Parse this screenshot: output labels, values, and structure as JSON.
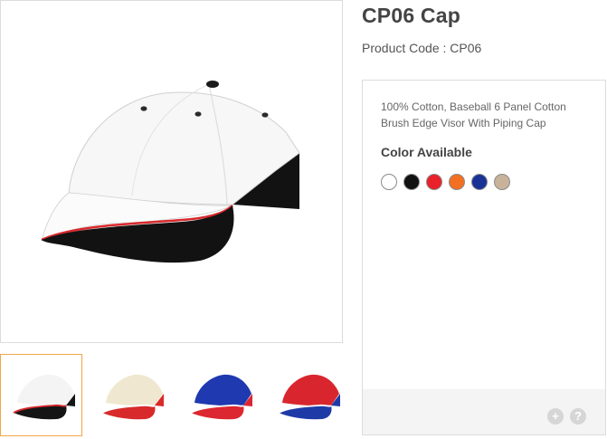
{
  "product": {
    "title": "CP06 Cap",
    "code_label": "Product Code : ",
    "code": "CP06",
    "description": "100% Cotton, Baseball 6 Panel Cotton Brush Edge Visor With Piping Cap",
    "color_heading": "Color Available"
  },
  "colors": [
    {
      "name": "white-swatch",
      "hex": "#ffffff"
    },
    {
      "name": "black-swatch",
      "hex": "#111111"
    },
    {
      "name": "red-swatch",
      "hex": "#e8212a"
    },
    {
      "name": "orange-swatch",
      "hex": "#f36f21"
    },
    {
      "name": "navy-swatch",
      "hex": "#1a3296"
    },
    {
      "name": "khaki-swatch",
      "hex": "#c8b39a"
    }
  ],
  "thumbnails": [
    {
      "name": "thumb-white-black",
      "crown": "#f4f4f4",
      "visor": "#151515",
      "trim": "#d8282c",
      "active": true
    },
    {
      "name": "thumb-beige-red",
      "crown": "#efe7cf",
      "visor": "#d82a2a",
      "trim": "#ffffff",
      "active": false
    },
    {
      "name": "thumb-blue-red",
      "crown": "#1f39b0",
      "visor": "#dc2630",
      "trim": "#ffffff",
      "active": false
    },
    {
      "name": "thumb-red-navy",
      "crown": "#d9262e",
      "visor": "#1e3aa6",
      "trim": "#ffffff",
      "active": false
    }
  ],
  "footer_icons": [
    {
      "name": "plus-icon",
      "glyph": "+"
    },
    {
      "name": "help-icon",
      "glyph": "?"
    }
  ]
}
